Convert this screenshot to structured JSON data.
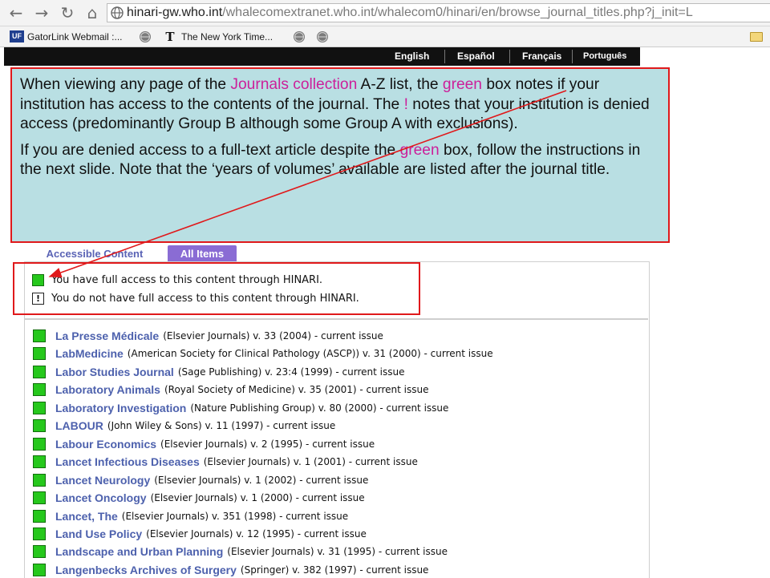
{
  "browser": {
    "back_icon": "←",
    "forward_icon": "→",
    "reload_icon": "↻",
    "home_icon": "⌂",
    "address": {
      "host": "hinari-gw.who.int",
      "rest": "/whalecomextranet.who.int/whalecom0/hinari/en/browse_journal_titles.php?j_init=L"
    }
  },
  "bookmarks": [
    {
      "label": "GatorLink Webmail :...",
      "icon": "uf-icon"
    },
    {
      "label": "",
      "icon": "globe-icon"
    },
    {
      "label": "The New York Time...",
      "icon": "nyt-icon"
    },
    {
      "label": "",
      "icon": "globe-icon"
    },
    {
      "label": "",
      "icon": "globe-icon"
    }
  ],
  "languages": [
    "English",
    "Español",
    "Français",
    "Português"
  ],
  "callout": {
    "p1": {
      "a": "When viewing any page of the ",
      "b": "Journals collection",
      "c": " A-Z list, the ",
      "d": "green",
      "e": " box notes if your institution has access to the contents of the journal. The ",
      "f": "!",
      "g": " notes that your institution is denied access (predominantly Group B although some Group A with exclusions)."
    },
    "p2": {
      "a": "If you are denied access to a full-text article despite the ",
      "b": "green",
      "c": " box, follow the instructions in the next slide.  Note that the ‘years of volumes’ available are listed after the journal title."
    },
    "highlight_color": "#cc1f9a",
    "border_color": "#e0191b"
  },
  "tabs": {
    "accessible": "Accessible Content",
    "all": "All Items"
  },
  "legend": {
    "full_access": "You have full access to this content through HINARI.",
    "no_access": "You do not have full access to this content through HINARI.",
    "no_access_symbol": "!"
  },
  "journals": [
    {
      "title": "La Presse Médicale",
      "details": "(Elsevier Journals) v. 33 (2004) - current issue"
    },
    {
      "title": "LabMedicine",
      "details": "(American Society for Clinical Pathology (ASCP)) v. 31 (2000) - current issue"
    },
    {
      "title": "Labor Studies Journal",
      "details": "(Sage Publishing) v. 23:4 (1999) - current issue"
    },
    {
      "title": "Laboratory Animals",
      "details": "(Royal Society of Medicine) v. 35 (2001) - current issue"
    },
    {
      "title": "Laboratory Investigation",
      "details": "(Nature Publishing Group) v. 80 (2000) - current issue"
    },
    {
      "title": "LABOUR",
      "details": "(John Wiley & Sons) v. 11 (1997) - current issue"
    },
    {
      "title": "Labour Economics",
      "details": "(Elsevier Journals) v. 2 (1995) - current issue"
    },
    {
      "title": "Lancet Infectious Diseases",
      "details": "(Elsevier Journals) v. 1 (2001) - current issue"
    },
    {
      "title": "Lancet Neurology",
      "details": "(Elsevier Journals) v. 1 (2002) - current issue"
    },
    {
      "title": "Lancet Oncology",
      "details": "(Elsevier Journals) v. 1 (2000) - current issue"
    },
    {
      "title": "Lancet, The",
      "details": "(Elsevier Journals) v. 351 (1998) - current issue"
    },
    {
      "title": "Land Use Policy",
      "details": "(Elsevier Journals) v. 12 (1995) - current issue"
    },
    {
      "title": "Landscape and Urban Planning",
      "details": "(Elsevier Journals) v. 31 (1995) - current issue"
    },
    {
      "title": "Langenbecks Archives of Surgery",
      "details": "(Springer) v. 382 (1997) - current issue"
    }
  ]
}
